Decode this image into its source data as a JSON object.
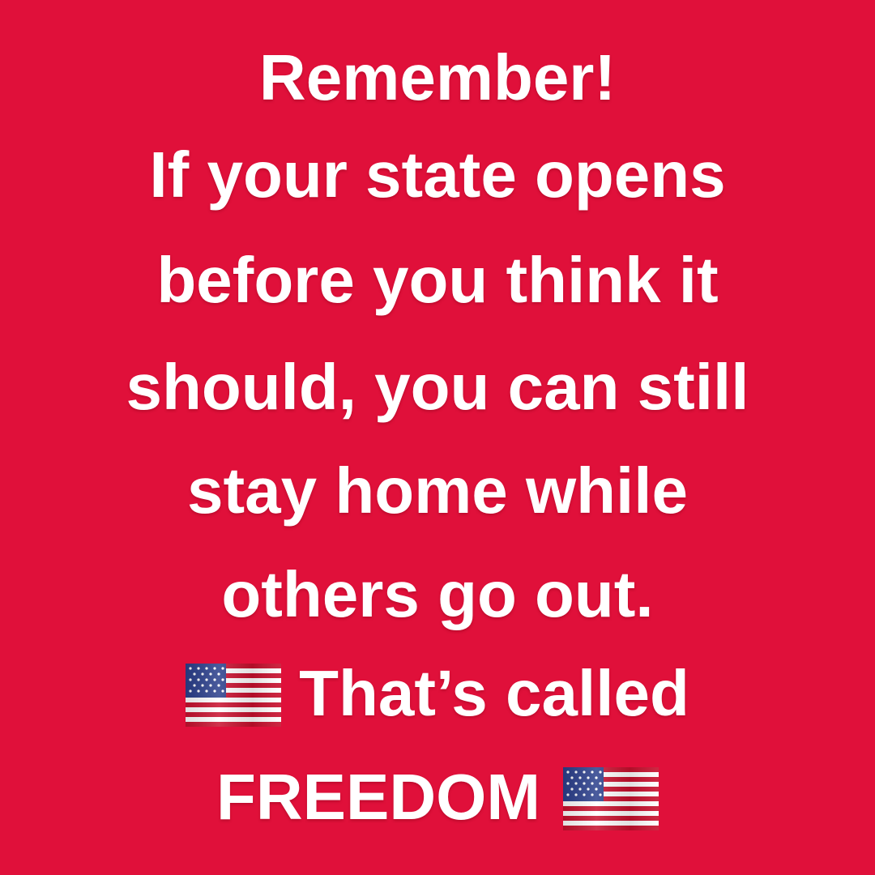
{
  "poster": {
    "lines": [
      "Remember!",
      "If your state opens",
      "before you think it",
      "should, you can still",
      "stay home while",
      "others go out."
    ],
    "closing_line_1": "That’s called",
    "closing_line_2": "FREEDOM"
  },
  "colors": {
    "background": "#e0103a",
    "text": "#ffffff"
  },
  "icons": [
    "us-flag-icon",
    "us-flag-icon"
  ]
}
